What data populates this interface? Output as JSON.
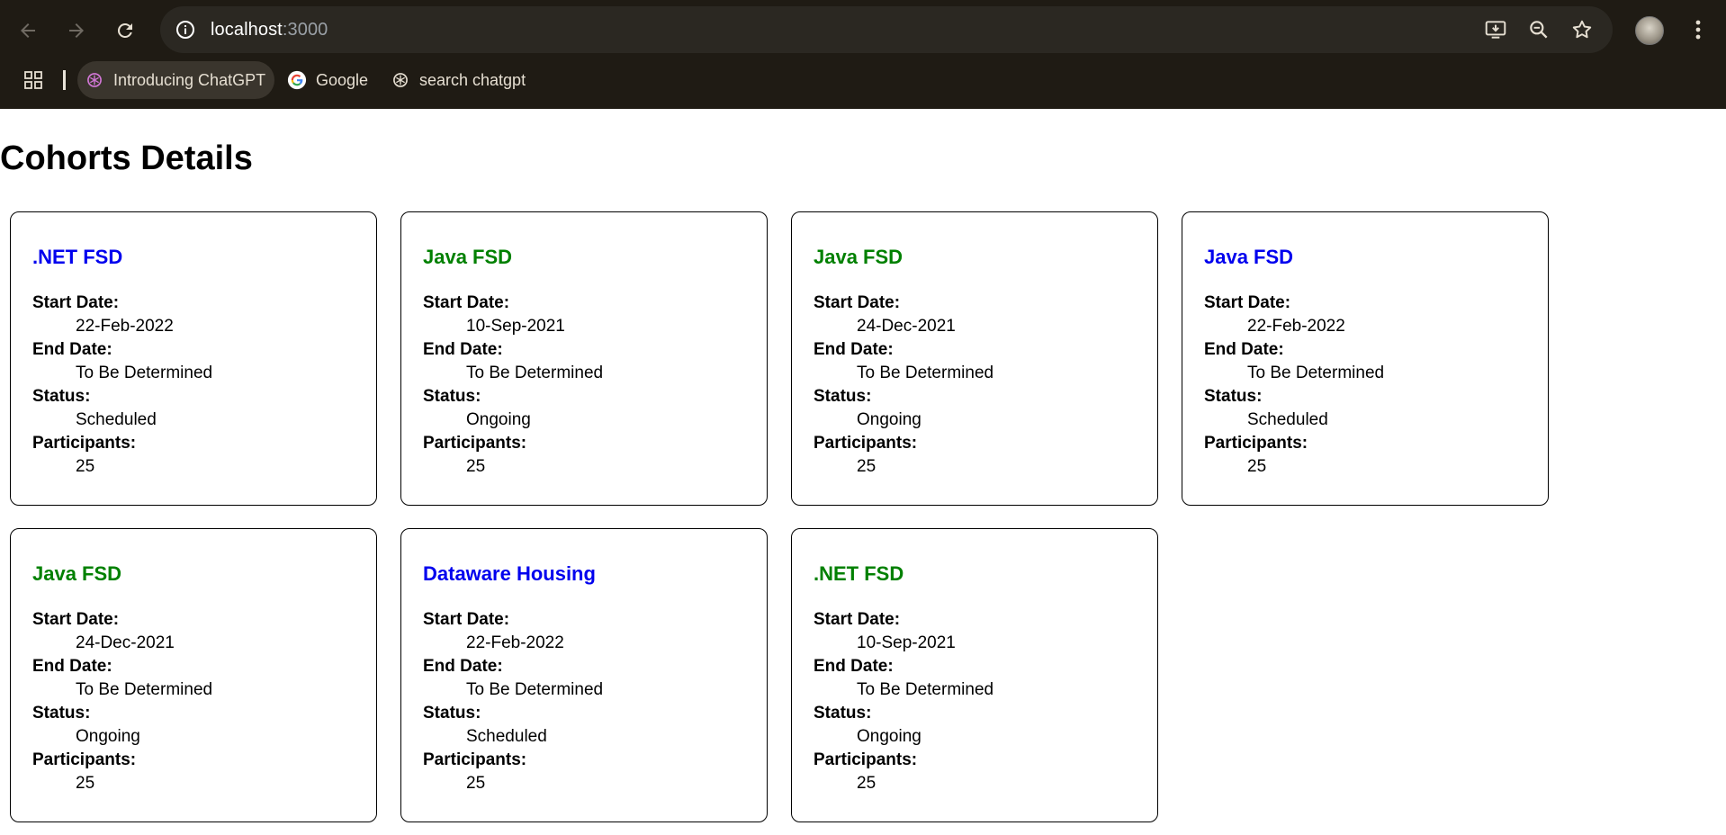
{
  "browser": {
    "url_host": "localhost",
    "url_port": ":3000",
    "bookmarks": [
      {
        "label": "Introducing ChatGPT",
        "icon": "chatgpt-icon"
      },
      {
        "label": "Google",
        "icon": "google-icon"
      },
      {
        "label": "search chatgpt",
        "icon": "chatgpt-icon"
      }
    ]
  },
  "page": {
    "title": "Cohorts Details",
    "field_labels": {
      "start": "Start Date:",
      "end": "End Date:",
      "status": "Status:",
      "participants": "Participants:"
    },
    "cohorts": [
      {
        "name": ".NET FSD",
        "title_color": "blue",
        "start": "22-Feb-2022",
        "end": "To Be Determined",
        "status": "Scheduled",
        "participants": "25"
      },
      {
        "name": "Java FSD",
        "title_color": "green",
        "start": "10-Sep-2021",
        "end": "To Be Determined",
        "status": "Ongoing",
        "participants": "25"
      },
      {
        "name": "Java FSD",
        "title_color": "green",
        "start": "24-Dec-2021",
        "end": "To Be Determined",
        "status": "Ongoing",
        "participants": "25"
      },
      {
        "name": "Java FSD",
        "title_color": "blue",
        "start": "22-Feb-2022",
        "end": "To Be Determined",
        "status": "Scheduled",
        "participants": "25"
      },
      {
        "name": "Java FSD",
        "title_color": "green",
        "start": "24-Dec-2021",
        "end": "To Be Determined",
        "status": "Ongoing",
        "participants": "25"
      },
      {
        "name": "Dataware Housing",
        "title_color": "blue",
        "start": "22-Feb-2022",
        "end": "To Be Determined",
        "status": "Scheduled",
        "participants": "25"
      },
      {
        "name": ".NET FSD",
        "title_color": "green",
        "start": "10-Sep-2021",
        "end": "To Be Determined",
        "status": "Ongoing",
        "participants": "25"
      }
    ]
  },
  "colors": {
    "chrome_bg": "#1f1b14",
    "omnibox_bg": "#2b2822",
    "title_blue": "#0000ee",
    "title_green": "#008000"
  }
}
